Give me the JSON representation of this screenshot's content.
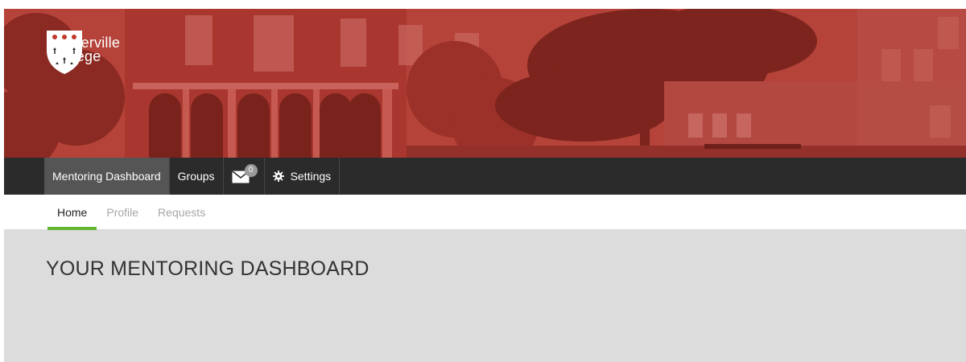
{
  "brand": {
    "line1": "Somerville",
    "line2": "College",
    "crest_color": "#ffffff",
    "star_color": "#c0392b"
  },
  "navbar": {
    "items": [
      {
        "label": "Mentoring Dashboard",
        "active": true
      },
      {
        "label": "Groups",
        "active": false
      },
      {
        "icon": "mail-icon",
        "badge": "0"
      },
      {
        "icon": "gear-icon",
        "label": "Settings"
      }
    ]
  },
  "subnav": {
    "tabs": [
      {
        "label": "Home",
        "active": true
      },
      {
        "label": "Profile",
        "active": false
      },
      {
        "label": "Requests",
        "active": false
      }
    ],
    "accent": "#63b52f"
  },
  "main": {
    "title": "YOUR MENTORING DASHBOARD"
  },
  "colors": {
    "hero": "#b8423a",
    "navbar": "#2b2b2b",
    "content_bg": "#dcdcdc"
  }
}
